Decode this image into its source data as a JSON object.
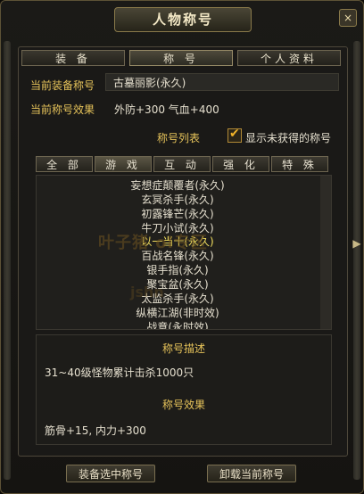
{
  "window": {
    "title": "人物称号",
    "close_icon": "×"
  },
  "tabs": [
    {
      "label": "装 备"
    },
    {
      "label": "称 号"
    },
    {
      "label": "个人资料"
    }
  ],
  "current": {
    "equip_label": "当前装备称号",
    "equip_value": "古墓丽影(永久)",
    "effect_label": "当前称号效果",
    "effect_value": "外防+300 气血+400"
  },
  "list": {
    "title": "称号列表",
    "show_unobtained_label": "显示未获得的称号",
    "show_unobtained_checked": true,
    "filters": [
      "全 部",
      "游 戏",
      "互 动",
      "强 化",
      "特 殊"
    ],
    "active_filter": 1,
    "items": [
      "妄想症颠覆者(永久)",
      "玄冥杀手(永久)",
      "初露锋芒(永久)",
      "牛刀小试(永久)",
      "以一当十(永久)",
      "百战名锋(永久)",
      "银手指(永久)",
      "聚宝盆(永久)",
      "太监杀手(永久)",
      "纵横江湖(非时效)",
      "战意(永时效)"
    ],
    "selected_index": 4,
    "watermark": "叶子猪 ol专区",
    "watermark2": "jshn"
  },
  "description": {
    "title": "称号描述",
    "text": "31~40级怪物累计击杀1000只",
    "effect_title": "称号效果",
    "effect_text": "筋骨+15, 内力+300"
  },
  "buttons": {
    "equip_selected": "装备选中称号",
    "unequip_current": "卸载当前称号"
  },
  "colors": {
    "label_gold": "#e6c35a",
    "selected_yellow": "#f2df5f"
  }
}
